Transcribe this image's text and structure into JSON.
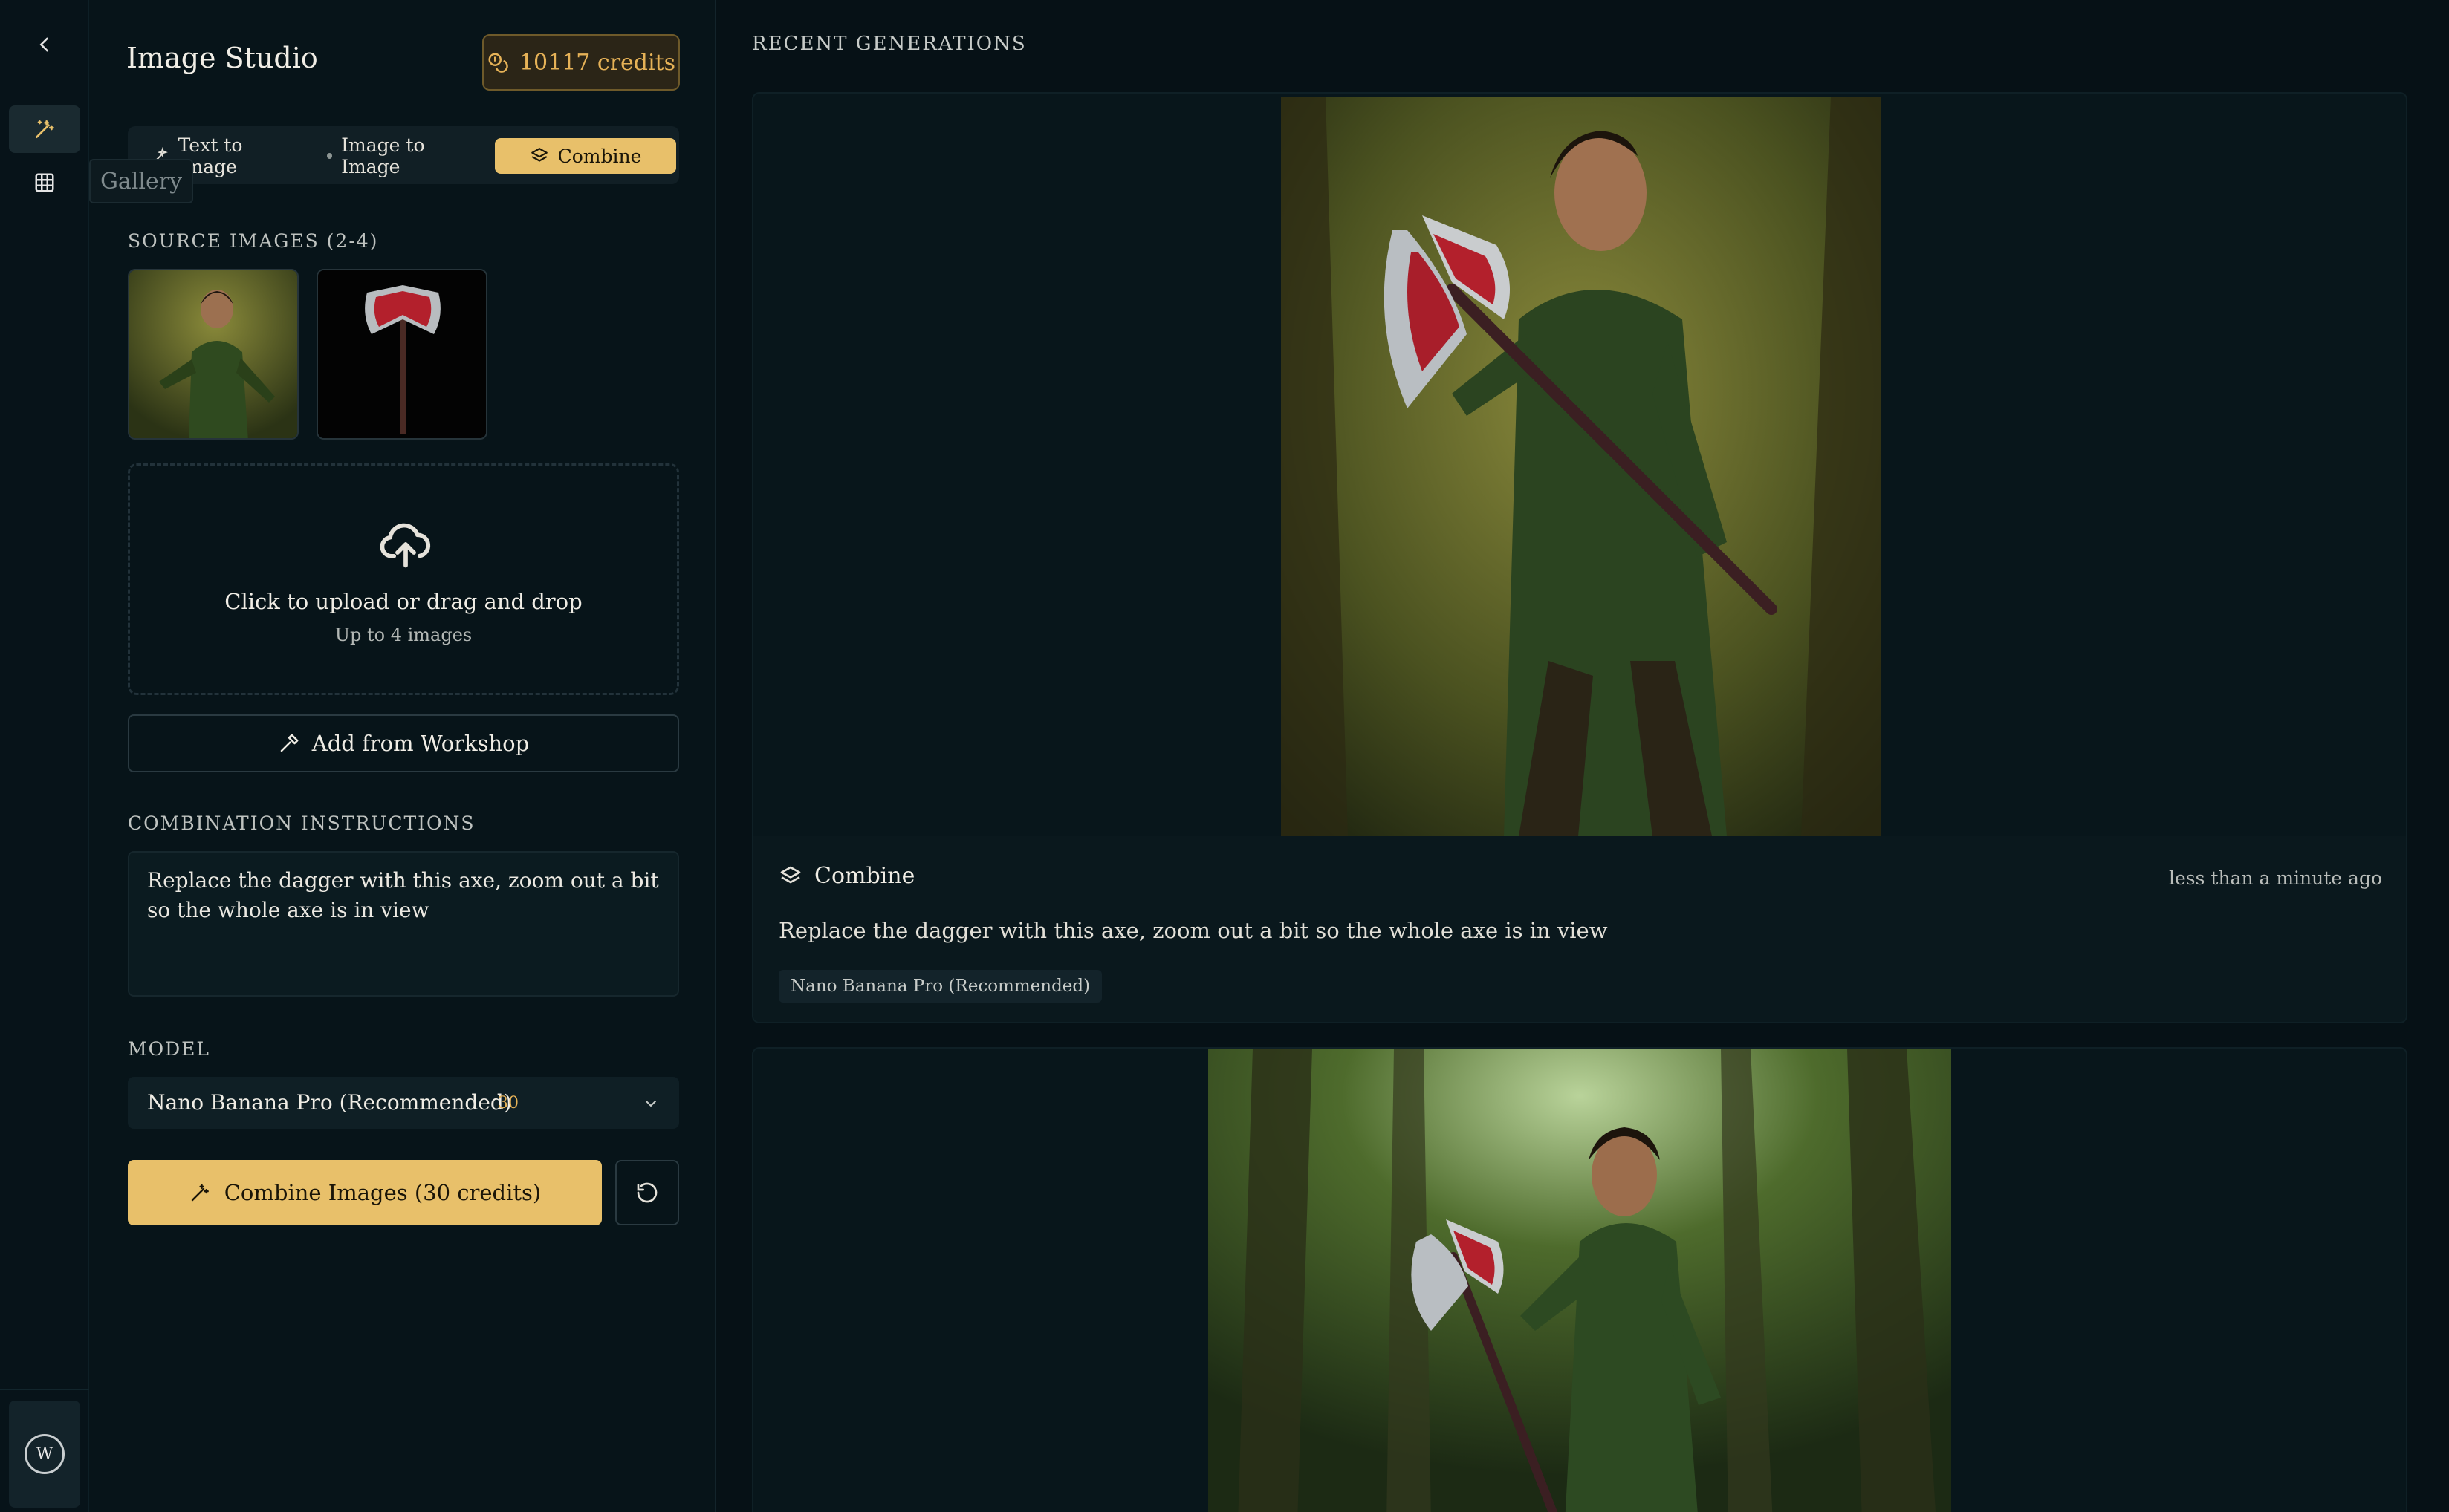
{
  "rail": {
    "items": [
      {
        "icon": "chevron-left-icon"
      },
      {
        "icon": "magic-wand-icon",
        "active": true
      },
      {
        "icon": "grid-icon"
      }
    ],
    "tooltip": "Gallery",
    "user_initial": "W"
  },
  "panel": {
    "title": "Image Studio",
    "credits": "10117 credits",
    "tabs": [
      {
        "label": "Text to Image",
        "icon": "sparkles-icon"
      },
      {
        "label": "Image to Image",
        "icon": "dot-icon"
      },
      {
        "label": "Combine",
        "icon": "layers-icon",
        "active": true
      }
    ],
    "source_label": "SOURCE IMAGES (2-4)",
    "upload": {
      "title": "Click to upload or drag and drop",
      "subtitle": "Up to 4 images"
    },
    "workshop_button": "Add from Workshop",
    "instructions_label": "COMBINATION INSTRUCTIONS",
    "instructions_value": "Replace the dagger with this axe, zoom out a bit so the whole axe is in view",
    "model_label": "MODEL",
    "model": {
      "name": "Nano Banana Pro (Recommended)",
      "cost": "30"
    },
    "combine_button": "Combine Images (30 credits)"
  },
  "main": {
    "section_label": "RECENT GENERATIONS",
    "cards": [
      {
        "type": "Combine",
        "time": "less than a minute ago",
        "prompt": "Replace the dagger with this axe, zoom out a bit so the whole axe is in view",
        "model": "Nano Banana Pro (Recommended)"
      }
    ]
  },
  "colors": {
    "accent": "#e8c06a",
    "background": "#061116",
    "panel": "#071419",
    "credit_text": "#e6b257"
  }
}
